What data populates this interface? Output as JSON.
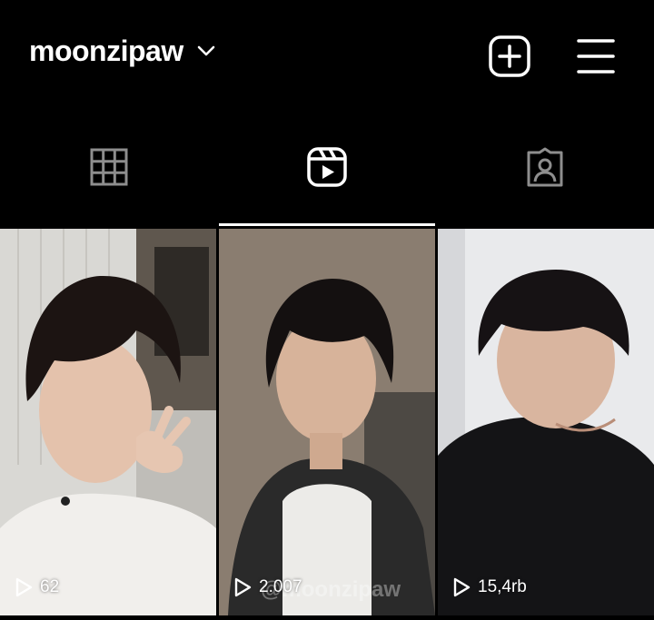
{
  "header": {
    "username": "moonzipaw",
    "icons": [
      "chevron-down-icon",
      "add-post-icon",
      "menu-icon"
    ]
  },
  "tabs": [
    {
      "name": "grid-tab",
      "icon": "grid-icon",
      "active": false
    },
    {
      "name": "reels-tab",
      "icon": "reels-icon",
      "active": true
    },
    {
      "name": "tagged-tab",
      "icon": "tagged-icon",
      "active": false
    }
  ],
  "reels": [
    {
      "views": "62"
    },
    {
      "views": "2.007",
      "watermark": "@moonzipaw"
    },
    {
      "views": "15,4rb"
    }
  ],
  "colors": {
    "background": "#000000",
    "inactive_icon": "#8e8e8e",
    "active": "#ffffff"
  }
}
